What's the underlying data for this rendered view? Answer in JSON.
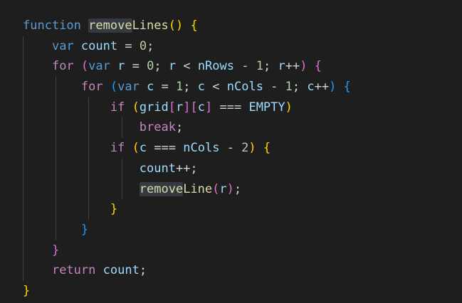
{
  "theme": {
    "background": "#1e1e1e",
    "keyword": "#569cd6",
    "control": "#c586c0",
    "function": "#dcdcaa",
    "variable": "#9cdcfe",
    "number": "#b5cea8",
    "text": "#d4d4d4",
    "bracket_level1": "#ffd700",
    "bracket_level2": "#da70d6",
    "bracket_level3": "#179fff",
    "word_highlight": "#343a40"
  },
  "lines": [
    {
      "indent": 0,
      "tokens": [
        {
          "t": "function",
          "c": "kw"
        },
        {
          "t": " ",
          "c": "op"
        },
        {
          "t": "remove",
          "c": "fn",
          "hl": true
        },
        {
          "t": "Lines",
          "c": "fn"
        },
        {
          "t": "()",
          "c": "br1"
        },
        {
          "t": " ",
          "c": "op"
        },
        {
          "t": "{",
          "c": "br1"
        }
      ]
    },
    {
      "indent": 1,
      "tokens": [
        {
          "t": "var",
          "c": "kw"
        },
        {
          "t": " ",
          "c": "op"
        },
        {
          "t": "count",
          "c": "vr"
        },
        {
          "t": " = ",
          "c": "op"
        },
        {
          "t": "0",
          "c": "num"
        },
        {
          "t": ";",
          "c": "op"
        }
      ]
    },
    {
      "indent": 1,
      "tokens": [
        {
          "t": "for",
          "c": "ctl"
        },
        {
          "t": " ",
          "c": "op"
        },
        {
          "t": "(",
          "c": "br2"
        },
        {
          "t": "var",
          "c": "kw"
        },
        {
          "t": " ",
          "c": "op"
        },
        {
          "t": "r",
          "c": "vr"
        },
        {
          "t": " = ",
          "c": "op"
        },
        {
          "t": "0",
          "c": "num"
        },
        {
          "t": "; ",
          "c": "op"
        },
        {
          "t": "r",
          "c": "vr"
        },
        {
          "t": " < ",
          "c": "op"
        },
        {
          "t": "nRows",
          "c": "vr"
        },
        {
          "t": " - ",
          "c": "op"
        },
        {
          "t": "1",
          "c": "num"
        },
        {
          "t": "; ",
          "c": "op"
        },
        {
          "t": "r",
          "c": "vr"
        },
        {
          "t": "++",
          "c": "op"
        },
        {
          "t": ")",
          "c": "br2"
        },
        {
          "t": " ",
          "c": "op"
        },
        {
          "t": "{",
          "c": "br2"
        }
      ]
    },
    {
      "indent": 2,
      "tokens": [
        {
          "t": "for",
          "c": "ctl"
        },
        {
          "t": " ",
          "c": "op"
        },
        {
          "t": "(",
          "c": "br3"
        },
        {
          "t": "var",
          "c": "kw"
        },
        {
          "t": " ",
          "c": "op"
        },
        {
          "t": "c",
          "c": "vr"
        },
        {
          "t": " = ",
          "c": "op"
        },
        {
          "t": "1",
          "c": "num"
        },
        {
          "t": "; ",
          "c": "op"
        },
        {
          "t": "c",
          "c": "vr"
        },
        {
          "t": " < ",
          "c": "op"
        },
        {
          "t": "nCols",
          "c": "vr"
        },
        {
          "t": " - ",
          "c": "op"
        },
        {
          "t": "1",
          "c": "num"
        },
        {
          "t": "; ",
          "c": "op"
        },
        {
          "t": "c",
          "c": "vr"
        },
        {
          "t": "++",
          "c": "op"
        },
        {
          "t": ")",
          "c": "br3"
        },
        {
          "t": " ",
          "c": "op"
        },
        {
          "t": "{",
          "c": "br3"
        }
      ]
    },
    {
      "indent": 3,
      "tokens": [
        {
          "t": "if",
          "c": "ctl"
        },
        {
          "t": " ",
          "c": "op"
        },
        {
          "t": "(",
          "c": "br1"
        },
        {
          "t": "grid",
          "c": "vr"
        },
        {
          "t": "[",
          "c": "br2"
        },
        {
          "t": "r",
          "c": "vr"
        },
        {
          "t": "]",
          "c": "br2"
        },
        {
          "t": "[",
          "c": "br2"
        },
        {
          "t": "c",
          "c": "vr"
        },
        {
          "t": "]",
          "c": "br2"
        },
        {
          "t": " === ",
          "c": "op"
        },
        {
          "t": "EMPTY",
          "c": "vr"
        },
        {
          "t": ")",
          "c": "br1"
        }
      ]
    },
    {
      "indent": 4,
      "tokens": [
        {
          "t": "break",
          "c": "ctl"
        },
        {
          "t": ";",
          "c": "op"
        }
      ]
    },
    {
      "indent": 3,
      "tokens": [
        {
          "t": "if",
          "c": "ctl"
        },
        {
          "t": " ",
          "c": "op"
        },
        {
          "t": "(",
          "c": "br1"
        },
        {
          "t": "c",
          "c": "vr"
        },
        {
          "t": " === ",
          "c": "op"
        },
        {
          "t": "nCols",
          "c": "vr"
        },
        {
          "t": " - ",
          "c": "op"
        },
        {
          "t": "2",
          "c": "num"
        },
        {
          "t": ")",
          "c": "br1"
        },
        {
          "t": " ",
          "c": "op"
        },
        {
          "t": "{",
          "c": "br1"
        }
      ]
    },
    {
      "indent": 4,
      "tokens": [
        {
          "t": "count",
          "c": "vr"
        },
        {
          "t": "++;",
          "c": "op"
        }
      ]
    },
    {
      "indent": 4,
      "tokens": [
        {
          "t": "remove",
          "c": "fn",
          "hl": true
        },
        {
          "t": "Line",
          "c": "fn"
        },
        {
          "t": "(",
          "c": "br2"
        },
        {
          "t": "r",
          "c": "vr"
        },
        {
          "t": ")",
          "c": "br2"
        },
        {
          "t": ";",
          "c": "op"
        }
      ]
    },
    {
      "indent": 3,
      "tokens": [
        {
          "t": "}",
          "c": "br1"
        }
      ]
    },
    {
      "indent": 2,
      "tokens": [
        {
          "t": "}",
          "c": "br3"
        }
      ]
    },
    {
      "indent": 1,
      "tokens": [
        {
          "t": "}",
          "c": "br2"
        }
      ]
    },
    {
      "indent": 1,
      "tokens": [
        {
          "t": "return",
          "c": "ctl"
        },
        {
          "t": " ",
          "c": "op"
        },
        {
          "t": "count",
          "c": "vr"
        },
        {
          "t": ";",
          "c": "op"
        }
      ]
    },
    {
      "indent": 0,
      "tokens": [
        {
          "t": "}",
          "c": "br1"
        }
      ]
    }
  ]
}
